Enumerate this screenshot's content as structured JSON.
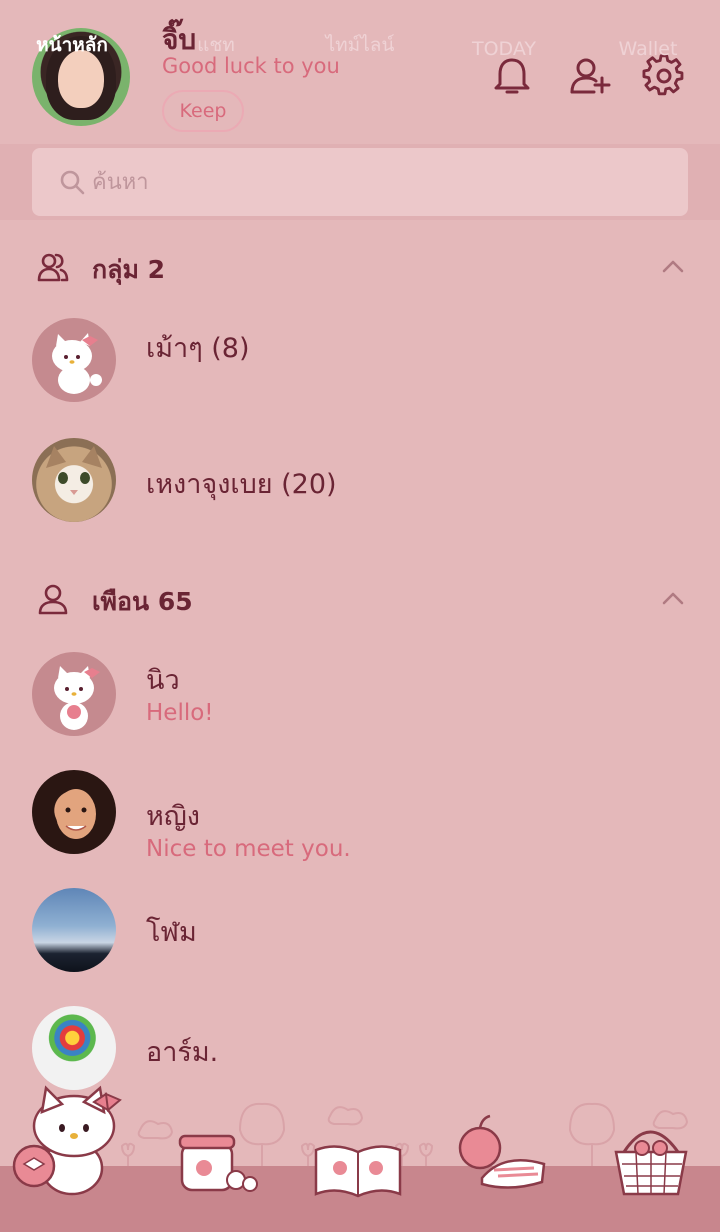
{
  "profile": {
    "name": "จิ๊บ",
    "status": "Good luck to you",
    "keep_label": "Keep"
  },
  "header_icons": [
    "bell-icon",
    "add-friend-icon",
    "gear-icon"
  ],
  "search": {
    "placeholder": "ค้นหา"
  },
  "groups": {
    "title": "กลุ่ม 2",
    "items": [
      {
        "name": "เม้าๆ (8)",
        "avatar": "hello-kitty-avatar"
      },
      {
        "name": "เหงาจุงเบย (20)",
        "avatar": "cat-photo-avatar"
      }
    ]
  },
  "friends": {
    "title": "เพือน 65",
    "items": [
      {
        "name": "นิว",
        "message": "Hello!",
        "avatar": "hello-kitty-avatar"
      },
      {
        "name": "หญิง",
        "message": "Nice to meet you.",
        "avatar": "woman-photo-avatar"
      },
      {
        "name": "โฬม",
        "message": "",
        "avatar": "sky-photo-avatar"
      },
      {
        "name": "อาร์ม.",
        "message": "",
        "avatar": "balloon-photo-avatar"
      }
    ]
  },
  "bottom_nav": {
    "items": [
      {
        "label": "หน้าหลัก",
        "active": true
      },
      {
        "label": "แชท",
        "active": false
      },
      {
        "label": "ไทม์ไลน์",
        "active": false
      },
      {
        "label": "TODAY",
        "active": false
      },
      {
        "label": "Wallet",
        "active": false
      }
    ]
  },
  "colors": {
    "background": "#e4b8ba",
    "accent_text": "#d86a7c",
    "primary_text": "#6a2434",
    "nav_bar": "#c8868d"
  }
}
